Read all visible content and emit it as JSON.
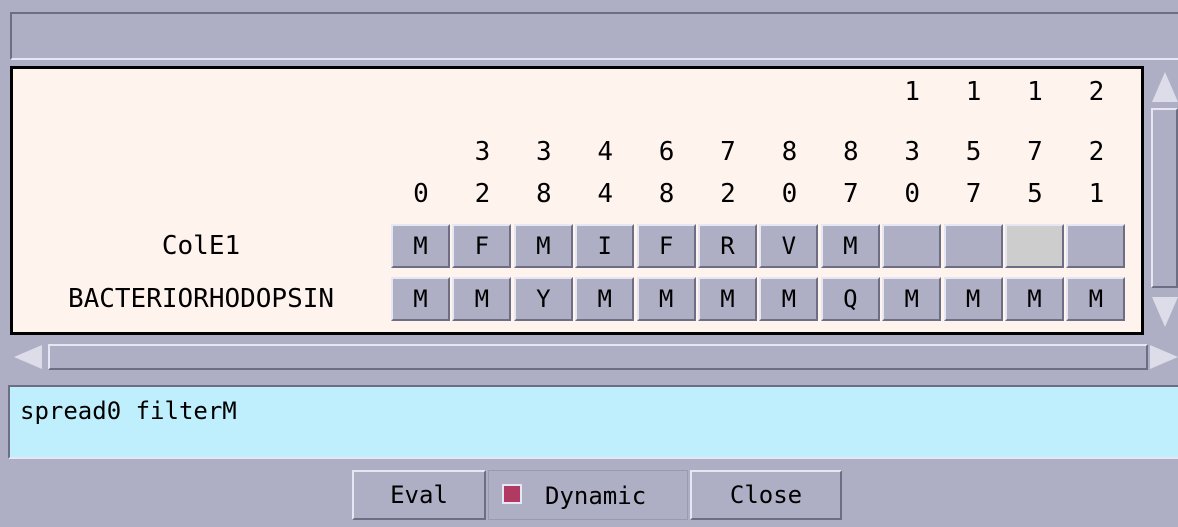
{
  "table": {
    "columns": [
      {
        "digits": [
          "",
          "",
          "0"
        ]
      },
      {
        "digits": [
          "",
          "3",
          "2"
        ]
      },
      {
        "digits": [
          "",
          "3",
          "8"
        ]
      },
      {
        "digits": [
          "",
          "4",
          "4"
        ]
      },
      {
        "digits": [
          "",
          "6",
          "8"
        ]
      },
      {
        "digits": [
          "",
          "7",
          "2"
        ]
      },
      {
        "digits": [
          "",
          "8",
          "0"
        ]
      },
      {
        "digits": [
          "",
          "8",
          "7"
        ]
      },
      {
        "digits": [
          "1",
          "3",
          "0"
        ]
      },
      {
        "digits": [
          "1",
          "5",
          "7"
        ]
      },
      {
        "digits": [
          "1",
          "7",
          "5"
        ]
      },
      {
        "digits": [
          "2",
          "2",
          "1"
        ]
      }
    ],
    "rows": [
      {
        "label": "ColE1",
        "cells": [
          "M",
          "F",
          "M",
          "I",
          "F",
          "R",
          "V",
          "M",
          "",
          "",
          "",
          ""
        ]
      },
      {
        "label": "BACTERIORHODOPSIN",
        "cells": [
          "M",
          "M",
          "Y",
          "M",
          "M",
          "M",
          "M",
          "Q",
          "M",
          "M",
          "M",
          "M"
        ]
      }
    ]
  },
  "command": {
    "text": "spread0 filterM"
  },
  "buttons": {
    "eval": "Eval",
    "dynamic": "Dynamic",
    "close": "Close"
  },
  "colors": {
    "command_bg": "#bfeffc",
    "table_bg": "#fff3ee",
    "checkbox": "#b03a62"
  }
}
